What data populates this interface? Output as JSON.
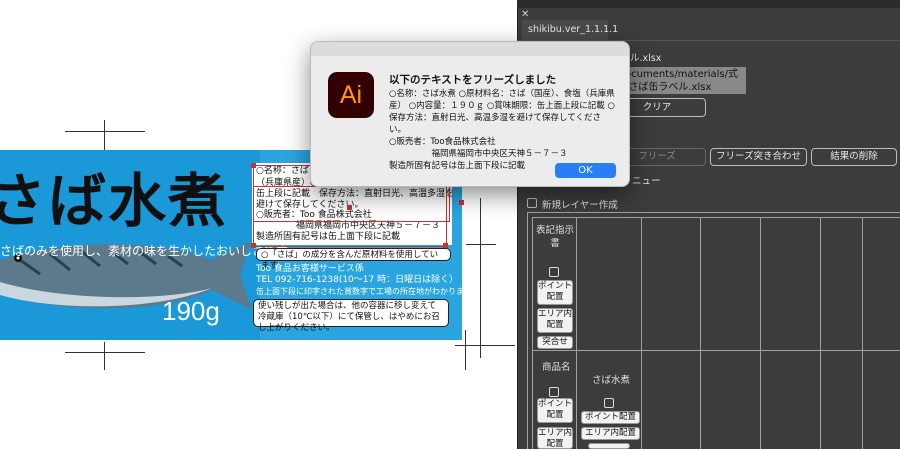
{
  "artboard": {
    "product_title": "さば水煮",
    "tagline": "さばのみを使用し、素材の味を生かしたおいしさです",
    "weight": "190g",
    "label_lines": [
      "○名称：さば",
      "（兵庫県産）○",
      "缶上段に記載　保存方法：直射日光、高温多湿を",
      "避けて保存してください。",
      "○販売者：Too 食品株式会社",
      "福岡県福岡市中央区天神５－７－３",
      "製造所固有記号は缶上面下段に記載"
    ],
    "allergen_note": "○「さば」の成分を含んだ原材料を使用しています",
    "service_lines": [
      "Too 食品お客様サービス係",
      "TEL 092-716-1238(10～17 時：日曜日は除く）",
      "缶上面下段に印字された賞数字で工場の所在地がわかります"
    ],
    "storage_note": "使い残しが出た場合は、他の容器に移し変えて冷蔵庫（10℃以下）にて保管し、はやめにお召し上がりください。"
  },
  "panel": {
    "tab_title": "shikibu.ver_1.1.1.1",
    "file_label": "ル.xlsx",
    "path_lines": [
      "ocuments/materials/式",
      "/さば缶ラベル.xlsx"
    ],
    "clear_button": "クリア",
    "freeze_button": "フリーズ",
    "freeze_match_button": "フリーズ突き合わせ",
    "clear_result_button": "結果の削除",
    "menu_label": "ニュー",
    "new_layer_label": "新規レイヤー作成",
    "row1_label": "表記指示書",
    "row2_label": "商品名",
    "row2_value": "さば水煮",
    "point_button": "ポイント配置",
    "area_button": "エリア内配置",
    "match_button": "突合せ"
  },
  "dialog": {
    "app_icon_text": "Ai",
    "heading": "以下のテキストをフリーズしました",
    "message": "○名称：さば水煮 ○原材料名：さば（国産）、食塩（兵庫県産） ○内容量：１９０ｇ ○賞味期限：缶上面上段に記載 ○保存方法：直射日光、高温多湿を避けて保存してください。\n○販売者：Too食品株式会社\n　　　　　福岡県福岡市中央区天神５－７－３\n製造所固有記号は缶上面下段に記載",
    "ok_button": "OK"
  },
  "colors": {
    "label_blue": "#2aa5e0",
    "selection_red": "#c83232",
    "ok_blue": "#2a7ef5",
    "panel_bg": "#3c3c3c"
  }
}
